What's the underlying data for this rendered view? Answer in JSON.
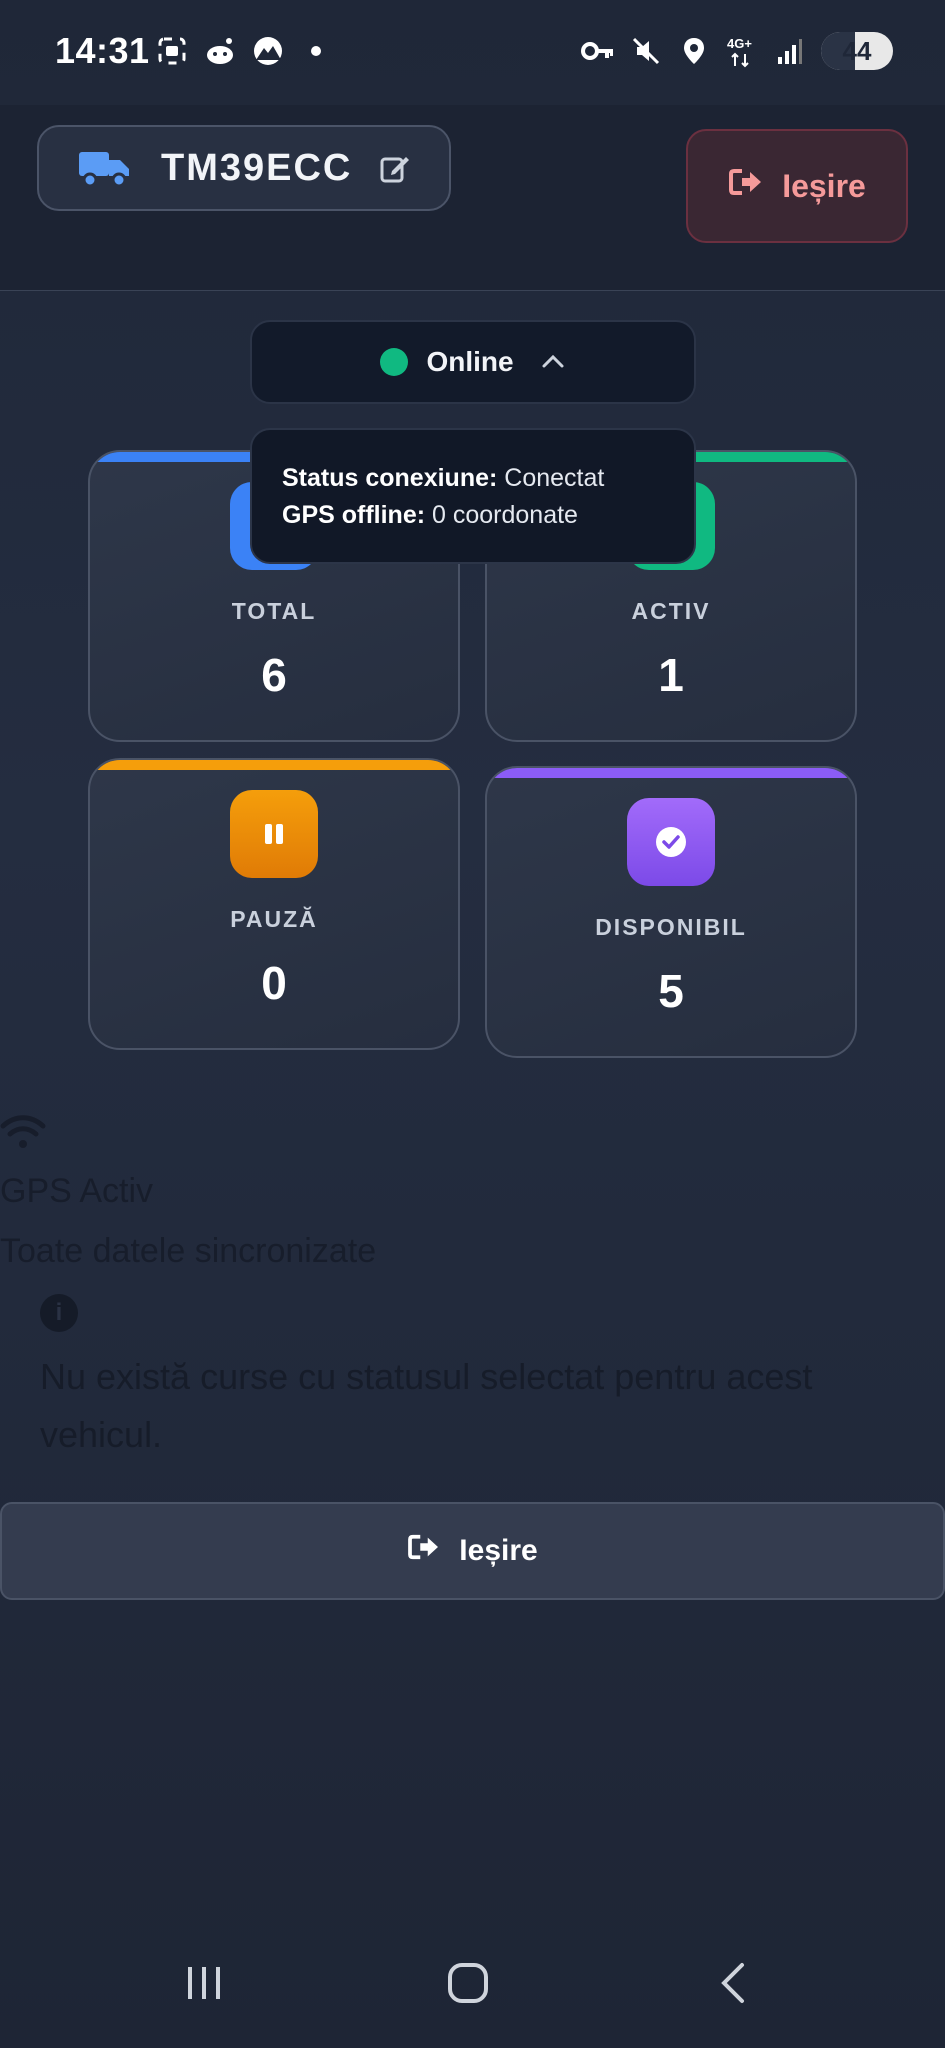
{
  "status_bar": {
    "time": "14:31",
    "network": "4G+",
    "battery": "44",
    "icons_left": [
      "screenshot-icon",
      "reddit-icon",
      "mountain-icon",
      "dot-icon"
    ],
    "icons_right": [
      "vpn-key-icon",
      "mute-icon",
      "location-icon",
      "network-icon",
      "signal-icon",
      "battery-icon"
    ]
  },
  "header": {
    "vehicle_plate": "TM39ECC",
    "exit_label": "Ieșire",
    "icons": {
      "vehicle": "truck-icon",
      "edit": "edit-icon",
      "exit": "sign-out-icon"
    }
  },
  "connection": {
    "status": "Online",
    "status_color": "#10b981",
    "tooltip": {
      "status_label": "Status conexiune:",
      "status_value": "Conectat",
      "gps_label": "GPS offline:",
      "gps_value": "0 coordonate"
    }
  },
  "stats": {
    "total": {
      "label": "TOTAL",
      "value": "6",
      "color": "#3b82f6"
    },
    "activ": {
      "label": "ACTIV",
      "value": "1",
      "color": "#10b981"
    },
    "pauza": {
      "label": "PAUZĂ",
      "value": "0",
      "color": "#f59e0b",
      "icon": "pause-icon"
    },
    "disponibil": {
      "label": "DISPONIBIL",
      "value": "5",
      "color": "#8b5cf6",
      "icon": "check-circle-icon"
    }
  },
  "gps_panel": {
    "gps_status": "GPS Activ",
    "sync_status": "Toate datele sincronizate",
    "empty_message": "Nu există curse cu statusul selectat pentru acest vehicul."
  },
  "footer": {
    "exit_label": "Ieșire"
  }
}
